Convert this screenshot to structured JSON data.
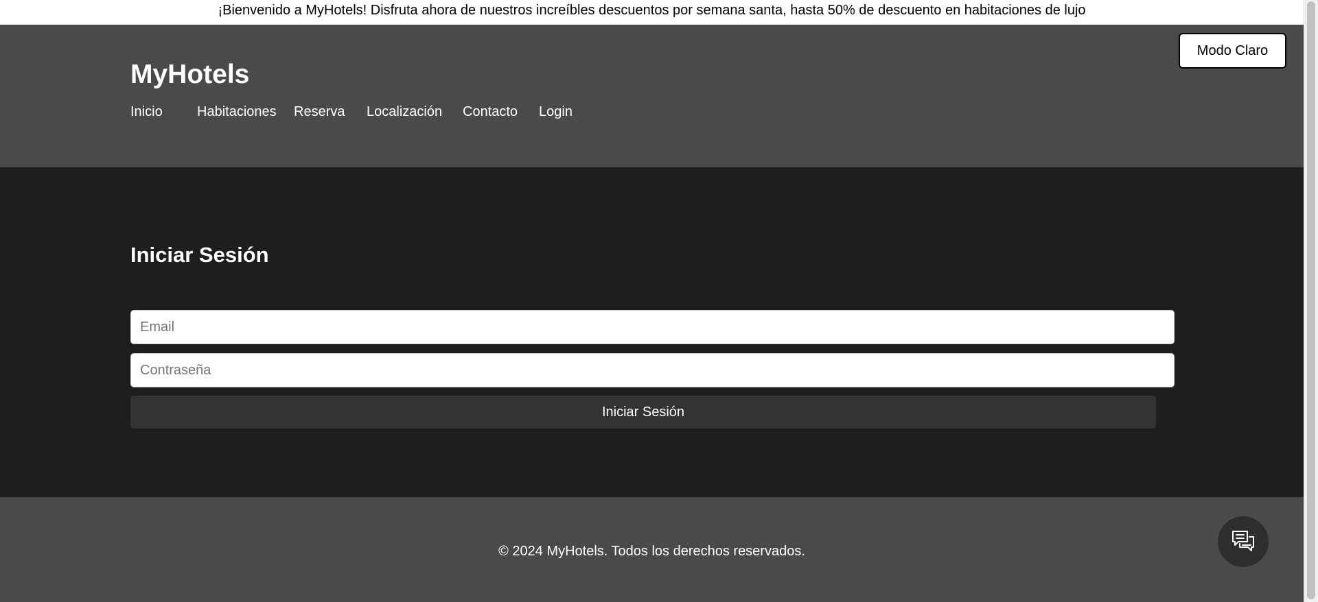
{
  "promo": {
    "text": "¡Bienvenido a MyHotels! Disfruta ahora de nuestros increíbles descuentos por semana santa, hasta 50% de descuento en habitaciones de lujo"
  },
  "header": {
    "brand": "MyHotels",
    "theme_toggle_label": "Modo Claro",
    "nav": [
      {
        "label": "Inicio"
      },
      {
        "label": "Habitaciones"
      },
      {
        "label": "Reserva"
      },
      {
        "label": "Localización"
      },
      {
        "label": "Contacto"
      },
      {
        "label": "Login"
      }
    ]
  },
  "login": {
    "title": "Iniciar Sesión",
    "email_placeholder": "Email",
    "password_placeholder": "Contraseña",
    "submit_label": "Iniciar Sesión"
  },
  "footer": {
    "copyright": "© 2024 MyHotels. Todos los derechos reservados.",
    "chat_icon": "chat-bubbles-icon"
  },
  "colors": {
    "header_bg": "#4a4a4a",
    "main_bg": "#1e1e1e",
    "button_bg": "#333333",
    "text": "#ffffff"
  }
}
